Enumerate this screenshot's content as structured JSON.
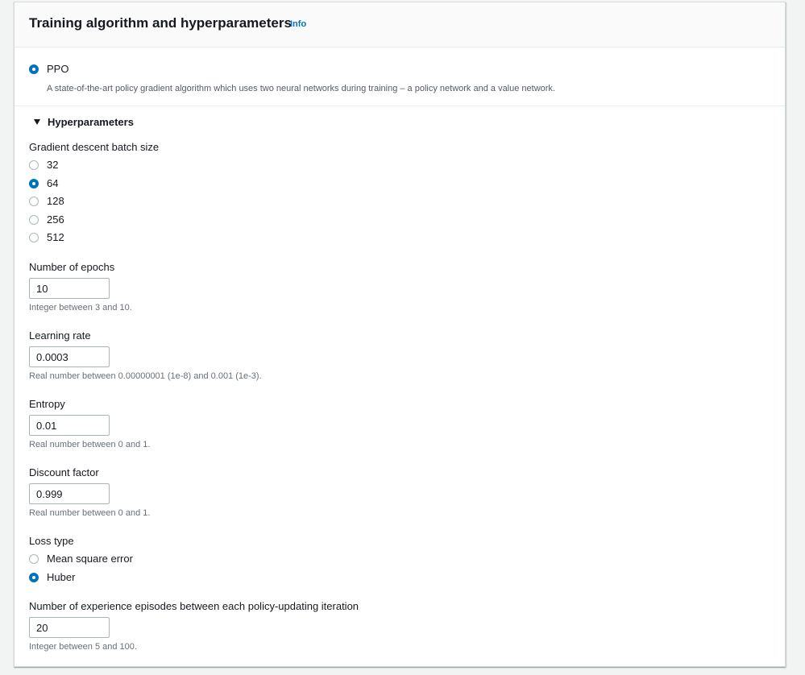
{
  "header": {
    "title": "Training algorithm and hyperparameters",
    "info": "Info"
  },
  "algorithm": {
    "option": "PPO",
    "description": "A state-of-the-art policy gradient algorithm which uses two neural networks during training – a policy network and a value network."
  },
  "hyperparameters": {
    "title": "Hyperparameters",
    "batch_size": {
      "label": "Gradient descent batch size",
      "options": [
        "32",
        "64",
        "128",
        "256",
        "512"
      ],
      "selected": "64"
    },
    "epochs": {
      "label": "Number of epochs",
      "value": "10",
      "hint": "Integer between 3 and 10."
    },
    "learning_rate": {
      "label": "Learning rate",
      "value": "0.0003",
      "hint": "Real number between 0.00000001 (1e-8) and 0.001 (1e-3)."
    },
    "entropy": {
      "label": "Entropy",
      "value": "0.01",
      "hint": "Real number between 0 and 1."
    },
    "discount": {
      "label": "Discount factor",
      "value": "0.999",
      "hint": "Real number between 0 and 1."
    },
    "loss_type": {
      "label": "Loss type",
      "options": [
        "Mean square error",
        "Huber"
      ],
      "selected": "Huber"
    },
    "episodes": {
      "label": "Number of experience episodes between each policy-updating iteration",
      "value": "20",
      "hint": "Integer between 5 and 100."
    }
  },
  "colors": {
    "accent": "#0073bb",
    "border": "#aab7b8",
    "hint": "#687078"
  }
}
